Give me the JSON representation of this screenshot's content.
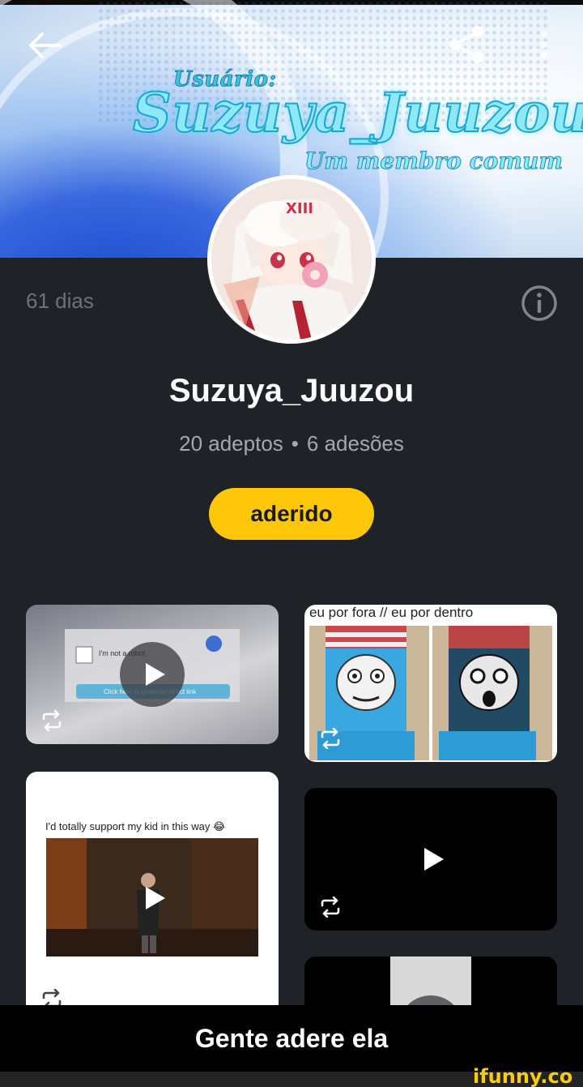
{
  "banner": {
    "subtitle_top": "Usuário:",
    "title": "Suzuya_Juuzou",
    "subtitle_bottom": "Um membro comum"
  },
  "profile": {
    "days": "61 dias",
    "name": "Suzuya_Juuzou",
    "followers": "20 adeptos",
    "separator": "•",
    "joined": "6 adesões",
    "join_button": "aderido"
  },
  "posts": [
    {
      "type": "video",
      "texts": [
        "I'm not a robot",
        "Click here to generate direct link"
      ]
    },
    {
      "type": "image",
      "caption": "eu por fora // eu por dentro"
    },
    {
      "type": "video",
      "caption": "I'd totally support my kid in this way 😂"
    },
    {
      "type": "video"
    },
    {
      "type": "video"
    }
  ],
  "caption": "Gente adere ela",
  "watermark": "ifunny.co",
  "colors": {
    "accent": "#ffc70a",
    "panel": "#1f2226",
    "muted_text": "#a4a9ae"
  }
}
